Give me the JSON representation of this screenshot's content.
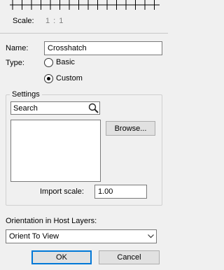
{
  "preview": {
    "scale_label": "Scale:",
    "scale_value": "1 : 1"
  },
  "name": {
    "label": "Name:",
    "value": "Crosshatch"
  },
  "type": {
    "label": "Type:",
    "options": [
      {
        "label": "Basic",
        "checked": false
      },
      {
        "label": "Custom",
        "checked": true
      }
    ]
  },
  "settings": {
    "title": "Settings",
    "search_placeholder": "Search",
    "browse_label": "Browse...",
    "import_scale_label": "Import scale:",
    "import_scale_value": "1.00"
  },
  "orientation": {
    "label": "Orientation in Host Layers:",
    "selected": "Orient To View"
  },
  "buttons": {
    "ok": "OK",
    "cancel": "Cancel"
  }
}
